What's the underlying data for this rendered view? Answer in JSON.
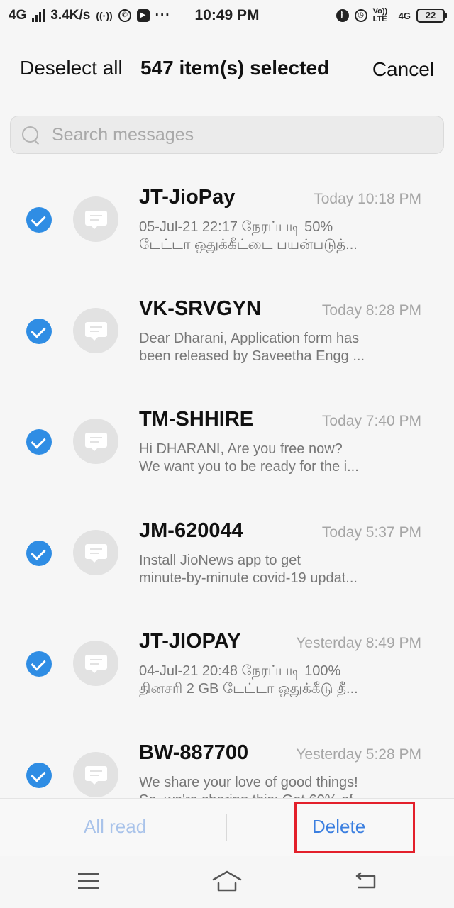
{
  "status_bar": {
    "network": "4G",
    "speed": "3.4K/s",
    "time": "10:49 PM",
    "volte": "Vo)) LTE",
    "net_right": "4G",
    "battery": "22",
    "icons": [
      "signal-icon",
      "hotspot-icon",
      "whatsapp-icon",
      "youtube-icon",
      "more-dots-icon",
      "bluetooth-icon",
      "alarm-icon",
      "battery-icon"
    ]
  },
  "header": {
    "deselect_label": "Deselect all",
    "selected_count": "547 item(s) selected",
    "cancel_label": "Cancel"
  },
  "search": {
    "placeholder": "Search messages"
  },
  "messages": [
    {
      "sender": "JT-JioPay",
      "time": "Today 10:18 PM",
      "line1": "05-Jul-21 22:17 நேரப்படி 50%",
      "line2": "டேட்டா ஒதுக்கீட்டை பயன்படுத்...",
      "selected": true
    },
    {
      "sender": "VK-SRVGYN",
      "time": "Today 8:28 PM",
      "line1": "Dear Dharani, Application form has",
      "line2": "been released by Saveetha Engg ...",
      "selected": true
    },
    {
      "sender": "TM-SHHIRE",
      "time": "Today 7:40 PM",
      "line1": "Hi DHARANI, Are you free now?",
      "line2": "We want you to be ready for the i...",
      "selected": true
    },
    {
      "sender": "JM-620044",
      "time": "Today 5:37 PM",
      "line1": "Install JioNews app to get",
      "line2": "minute-by-minute covid-19 updat...",
      "selected": true
    },
    {
      "sender": "JT-JIOPAY",
      "time": "Yesterday 8:49 PM",
      "line1": "04-Jul-21 20:48 நேரப்படி 100%",
      "line2": "தினசரி 2 GB டேட்டா ஒதுக்கீடு தீ...",
      "selected": true
    },
    {
      "sender": "BW-887700",
      "time": "Yesterday 5:28 PM",
      "line1": "We share your love of good things!",
      "line2": "So, we're sharing this: Get 60% of",
      "selected": true
    }
  ],
  "actions": {
    "all_read_label": "All read",
    "delete_label": "Delete"
  },
  "colors": {
    "accent": "#2f8de4",
    "delete": "#3b7fe0",
    "all_read_disabled": "#a9c3ea",
    "highlight": "#e3202b"
  }
}
